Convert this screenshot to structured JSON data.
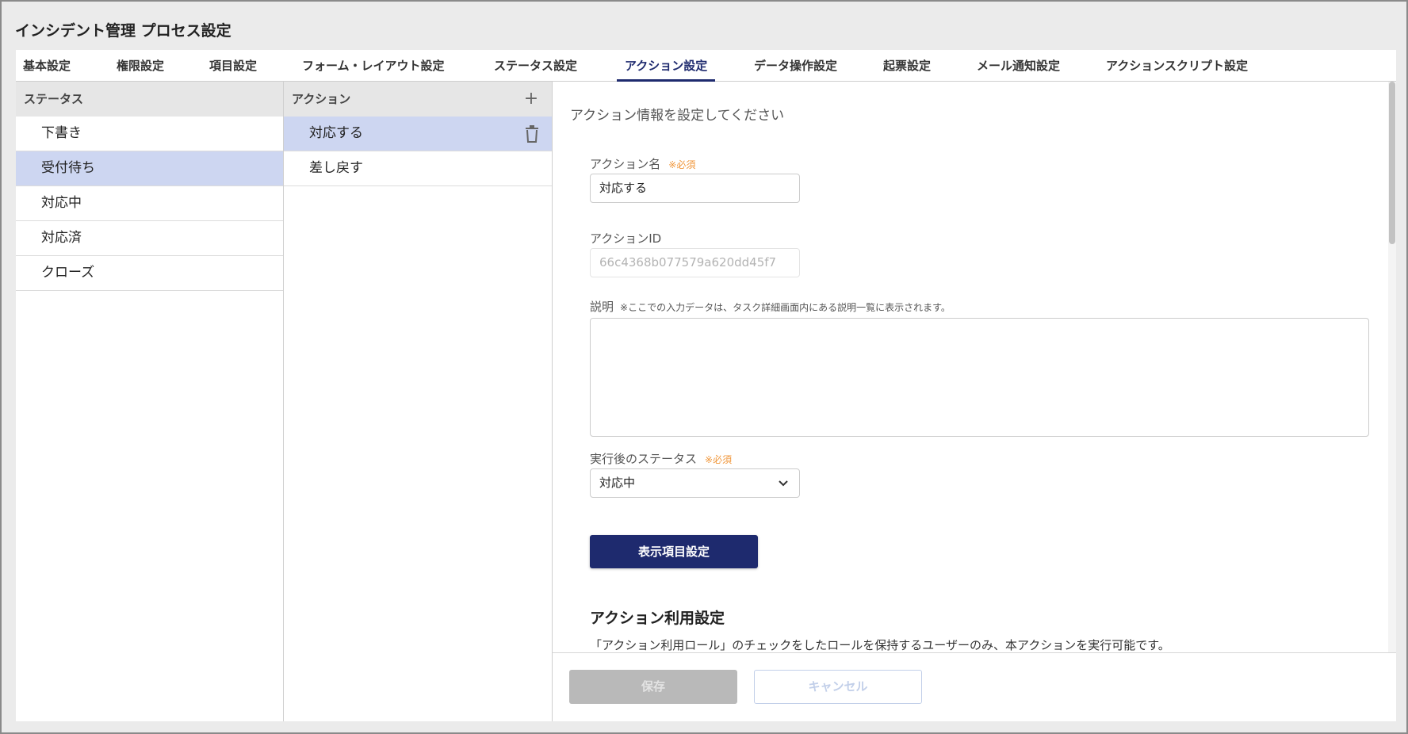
{
  "page": {
    "title": "インシデント管理 プロセス設定"
  },
  "tabs": [
    {
      "label": "基本設定"
    },
    {
      "label": "権限設定"
    },
    {
      "label": "項目設定"
    },
    {
      "label": "フォーム・レイアウト設定"
    },
    {
      "label": "ステータス設定"
    },
    {
      "label": "アクション設定",
      "active": true
    },
    {
      "label": "データ操作設定"
    },
    {
      "label": "起票設定"
    },
    {
      "label": "メール通知設定"
    },
    {
      "label": "アクションスクリプト設定"
    }
  ],
  "status_column": {
    "header": "ステータス",
    "items": [
      {
        "label": "下書き"
      },
      {
        "label": "受付待ち",
        "selected": true
      },
      {
        "label": "対応中"
      },
      {
        "label": "対応済"
      },
      {
        "label": "クローズ"
      }
    ]
  },
  "action_column": {
    "header": "アクション",
    "add_icon": "plus-icon",
    "items": [
      {
        "label": "対応する",
        "selected": true
      },
      {
        "label": "差し戻す"
      }
    ]
  },
  "detail": {
    "intro": "アクション情報を設定してください",
    "action_name": {
      "label": "アクション名",
      "required": "※必須",
      "value": "対応する"
    },
    "action_id": {
      "label": "アクションID",
      "value": "66c4368b077579a620dd45f7"
    },
    "description": {
      "label": "説明",
      "note": "※ここでの入力データは、タスク詳細画面内にある説明一覧に表示されます。",
      "value": ""
    },
    "next_status": {
      "label": "実行後のステータス",
      "required": "※必須",
      "selected": "対応中"
    },
    "display_button": "表示項目設定",
    "usage_title": "アクション利用設定",
    "usage_desc": "「アクション利用ロール」のチェックをしたロールを保持するユーザーのみ、本アクションを実行可能です。"
  },
  "footer": {
    "save": "保存",
    "cancel": "キャンセル"
  },
  "colors": {
    "accent": "#1e2a6e",
    "selected_row": "#cdd6f1",
    "required": "#f0963a"
  }
}
